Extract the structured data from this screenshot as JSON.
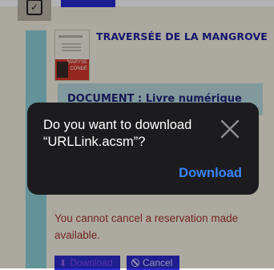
{
  "book": {
    "title": "TRAVERSÉE DE LA MANGROVE",
    "cover_text": "MARYSE CONDÉ"
  },
  "document": {
    "label": "DOCUMENT : Livre numérique"
  },
  "warning": {
    "text": "You cannot cancel a reservation made available."
  },
  "actions": {
    "download_label": "Download",
    "cancel_label": "Cancel"
  },
  "dialog": {
    "message": "Do you want to download “URLLink.acsm”?",
    "download_label": "Download",
    "close_icon": "close-icon"
  },
  "colors": {
    "accent_blue": "#2b2bcd",
    "title_blue": "#1d1d9b",
    "warning_red": "#a63a32",
    "band_teal": "#8fd3da",
    "dialog_bg": "#1c1c1e",
    "dialog_link": "#3a86ff"
  }
}
